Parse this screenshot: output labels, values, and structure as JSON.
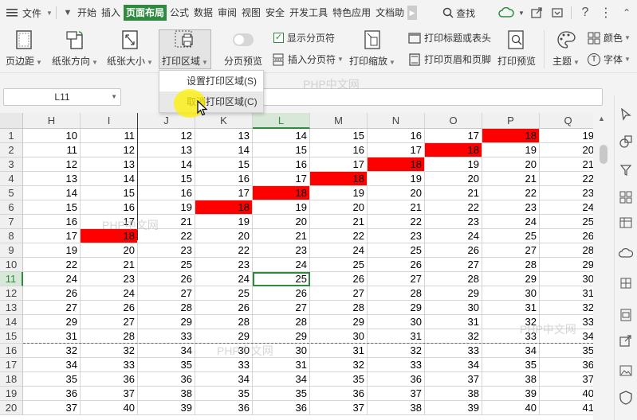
{
  "menubar": {
    "file_label": "文件",
    "tabs": [
      {
        "label": "开始",
        "active": false
      },
      {
        "label": "插入",
        "active": false
      },
      {
        "label": "页面布局",
        "active": true
      },
      {
        "label": "公式",
        "active": false
      },
      {
        "label": "数据",
        "active": false
      },
      {
        "label": "审阅",
        "active": false
      },
      {
        "label": "视图",
        "active": false
      },
      {
        "label": "安全",
        "active": false
      },
      {
        "label": "开发工具",
        "active": false
      },
      {
        "label": "特色应用",
        "active": false
      },
      {
        "label": "文档助",
        "active": false
      }
    ],
    "search_label": "查找",
    "icons": [
      "menu-icon",
      "cloud-sync-icon",
      "share-icon",
      "collapse-icon",
      "help-icon",
      "more-icon",
      "minimize-icon"
    ]
  },
  "ribbon": {
    "margins_label": "页边距",
    "orientation_label": "纸张方向",
    "size_label": "纸张大小",
    "print_area_label": "打印区域",
    "page_break_preview_label": "分页预览",
    "show_page_breaks_label": "显示分页符",
    "show_page_breaks_checked": true,
    "insert_page_break_label": "插入分页符",
    "print_titles_label": "打印标题或表头",
    "print_scaling_label": "打印缩放",
    "header_footer_label": "打印页眉和页脚",
    "print_preview_label": "打印预览",
    "theme_label": "主题",
    "colors_label": "颜色",
    "fonts_label": "字体"
  },
  "dropdown": {
    "items": [
      {
        "label": "设置打印区域(S)",
        "hover": false
      },
      {
        "label": "取消打印区域(C)",
        "hover": true
      }
    ]
  },
  "formula_bar": {
    "name_box": "L11",
    "formula": ""
  },
  "sheet": {
    "columns": [
      "H",
      "I",
      "J",
      "K",
      "L",
      "M",
      "N",
      "O",
      "P",
      "Q"
    ],
    "selected_column": "L",
    "selected_row": "11",
    "active_cell": "L11",
    "rows": [
      {
        "num": "1",
        "cells": [
          "10",
          "11",
          "12",
          "13",
          "14",
          "15",
          "16",
          "17",
          "18",
          "19"
        ]
      },
      {
        "num": "2",
        "cells": [
          "11",
          "12",
          "13",
          "14",
          "15",
          "16",
          "17",
          "18",
          "19",
          "20"
        ]
      },
      {
        "num": "3",
        "cells": [
          "12",
          "13",
          "14",
          "15",
          "16",
          "17",
          "18",
          "19",
          "20",
          "21"
        ]
      },
      {
        "num": "4",
        "cells": [
          "13",
          "14",
          "15",
          "16",
          "17",
          "18",
          "19",
          "20",
          "21",
          "22"
        ]
      },
      {
        "num": "5",
        "cells": [
          "14",
          "15",
          "16",
          "17",
          "18",
          "19",
          "20",
          "21",
          "22",
          "23"
        ]
      },
      {
        "num": "6",
        "cells": [
          "15",
          "16",
          "19",
          "18",
          "19",
          "20",
          "21",
          "22",
          "23",
          "24"
        ]
      },
      {
        "num": "7",
        "cells": [
          "16",
          "17",
          "21",
          "19",
          "20",
          "21",
          "22",
          "23",
          "24",
          "25"
        ]
      },
      {
        "num": "8",
        "cells": [
          "17",
          "18",
          "22",
          "20",
          "21",
          "22",
          "23",
          "24",
          "25",
          "26"
        ]
      },
      {
        "num": "9",
        "cells": [
          "19",
          "20",
          "23",
          "22",
          "23",
          "24",
          "25",
          "26",
          "27",
          "28"
        ]
      },
      {
        "num": "10",
        "cells": [
          "22",
          "21",
          "25",
          "23",
          "24",
          "25",
          "26",
          "27",
          "28",
          "29"
        ]
      },
      {
        "num": "11",
        "cells": [
          "24",
          "23",
          "26",
          "24",
          "25",
          "26",
          "27",
          "28",
          "29",
          "30"
        ]
      },
      {
        "num": "12",
        "cells": [
          "26",
          "24",
          "27",
          "25",
          "26",
          "27",
          "28",
          "29",
          "30",
          "31"
        ]
      },
      {
        "num": "13",
        "cells": [
          "27",
          "26",
          "28",
          "26",
          "27",
          "28",
          "29",
          "30",
          "31",
          "32"
        ]
      },
      {
        "num": "14",
        "cells": [
          "29",
          "27",
          "29",
          "28",
          "28",
          "29",
          "30",
          "31",
          "32",
          "33"
        ]
      },
      {
        "num": "15",
        "cells": [
          "31",
          "28",
          "33",
          "29",
          "29",
          "30",
          "31",
          "32",
          "33",
          "34"
        ]
      },
      {
        "num": "16",
        "cells": [
          "32",
          "32",
          "34",
          "30",
          "30",
          "31",
          "32",
          "33",
          "34",
          "35"
        ]
      },
      {
        "num": "17",
        "cells": [
          "34",
          "33",
          "35",
          "33",
          "31",
          "32",
          "33",
          "34",
          "35",
          "36"
        ]
      },
      {
        "num": "18",
        "cells": [
          "35",
          "36",
          "36",
          "34",
          "34",
          "35",
          "36",
          "37",
          "38",
          "37"
        ]
      },
      {
        "num": "19",
        "cells": [
          "36",
          "37",
          "38",
          "35",
          "35",
          "36",
          "37",
          "38",
          "39",
          "40"
        ]
      },
      {
        "num": "20",
        "cells": [
          "37",
          "40",
          "39",
          "36",
          "36",
          "37",
          "38",
          "39",
          "40",
          "41"
        ]
      }
    ],
    "red_cells": [
      {
        "row": 0,
        "col": 8
      },
      {
        "row": 1,
        "col": 7
      },
      {
        "row": 2,
        "col": 6
      },
      {
        "row": 3,
        "col": 5
      },
      {
        "row": 4,
        "col": 4
      },
      {
        "row": 5,
        "col": 3
      },
      {
        "row": 7,
        "col": 1
      }
    ],
    "highlight_color": "#ff0000",
    "accent_color": "#2f8a3f"
  },
  "watermark": "PHP中文网"
}
